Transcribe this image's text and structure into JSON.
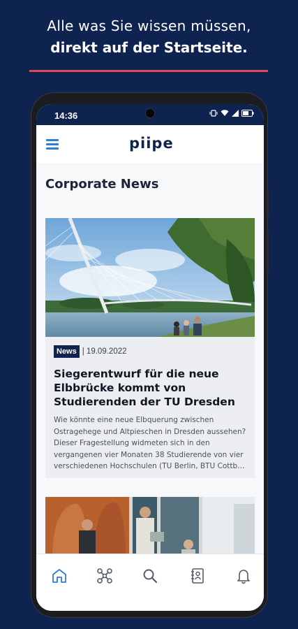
{
  "promo": {
    "line1": "Alle was Sie wissen müssen,",
    "line2": "direkt auf der Startseite."
  },
  "statusbar": {
    "time": "14:36"
  },
  "appbar": {
    "logo": "piipe"
  },
  "main": {
    "section_title": "Corporate News",
    "articles": [
      {
        "badge": "News",
        "date": "| 19.09.2022",
        "title": "Siegerentwurf für die neue Elbbrücke kommt von Studierenden der TU Dresden",
        "teaser_lines": [
          "Wie könnte eine neue Elbquerung zwischen",
          "Ostragehege und Altpieschen in Dresden aussehen?",
          "Dieser Fragestellung widmeten sich in den",
          "vergangenen vier Monaten 38 Studierende von vier",
          "verschiedenen Hochschulen (TU Berlin, BTU Cottbus…"
        ]
      }
    ]
  },
  "bottom_nav": [
    {
      "icon": "home-icon",
      "active": true
    },
    {
      "icon": "network-icon",
      "active": false
    },
    {
      "icon": "search-icon",
      "active": false
    },
    {
      "icon": "contacts-icon",
      "active": false
    },
    {
      "icon": "bell-icon",
      "active": false
    }
  ],
  "colors": {
    "background": "#0f2350",
    "accent_line": "#e0485a",
    "accent_blue": "#2f7bd6",
    "badge": "#0f2350"
  }
}
